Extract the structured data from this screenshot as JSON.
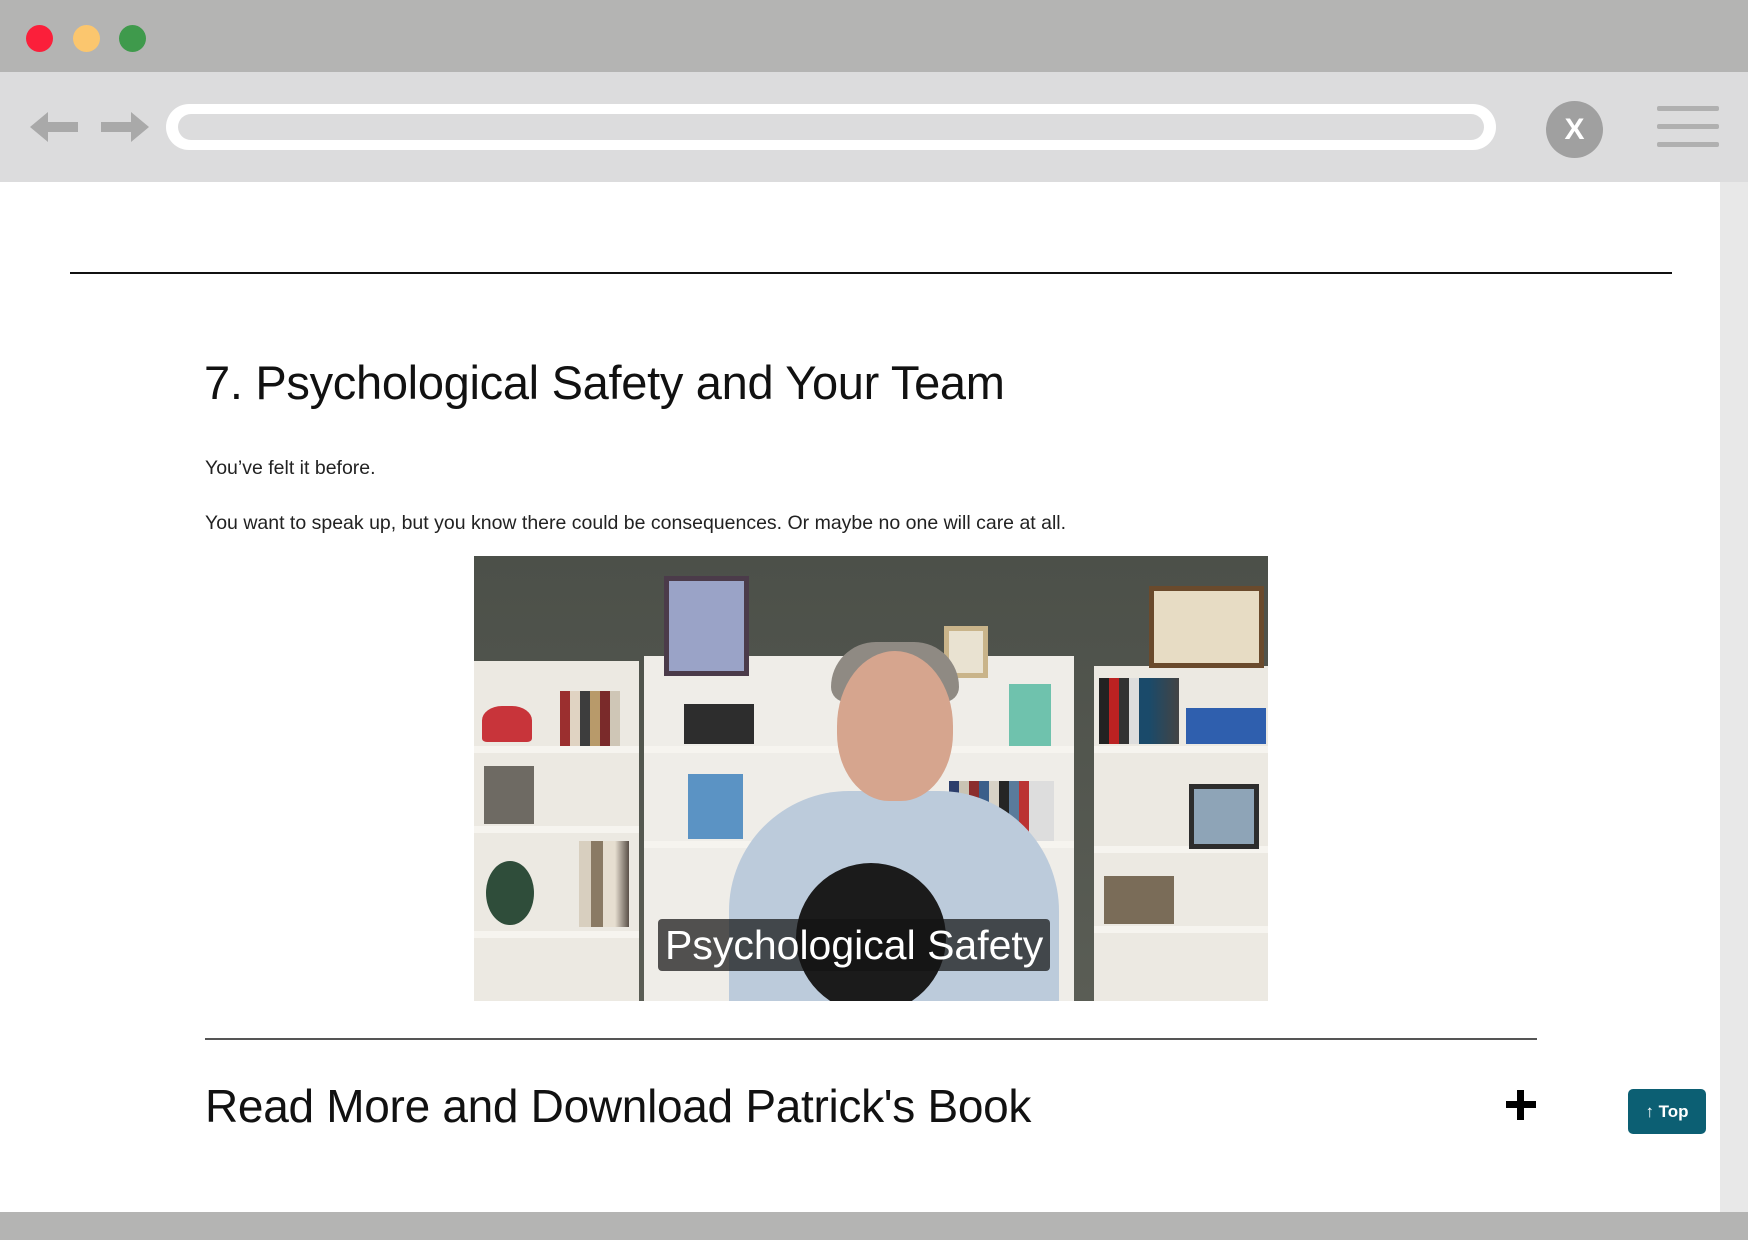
{
  "browser": {
    "window_controls": [
      "close",
      "minimize",
      "maximize"
    ],
    "back_icon": "arrow-left-icon",
    "forward_icon": "arrow-right-icon",
    "address": "",
    "stop_icon": "close-icon",
    "stop_label": "X",
    "menu_icon": "hamburger-menu-icon"
  },
  "article": {
    "heading": "7. Psychological Safety and Your Team",
    "paragraphs": [
      "You’ve felt it before.",
      "You want to speak up, but you know there could be consequences. Or maybe no one will care at all."
    ],
    "video": {
      "caption": "Psychological Safety"
    }
  },
  "accordion": {
    "title": "Read More and Download Patrick's Book",
    "toggle_icon": "plus-icon"
  },
  "back_to_top": {
    "label": "↑ Top",
    "color": "#0c5f73"
  }
}
